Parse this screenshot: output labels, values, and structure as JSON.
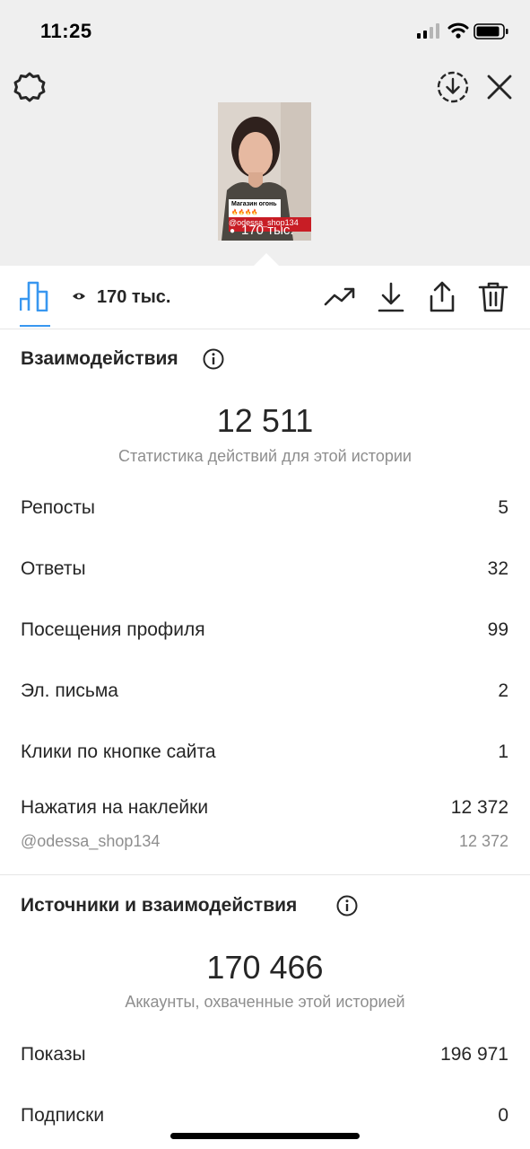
{
  "status_bar": {
    "time": "11:25"
  },
  "story": {
    "caption_title": "Магазин огонь",
    "mention": "@odessa_shop134",
    "views": "170 тыс."
  },
  "toolbar": {
    "views": "170 тыс."
  },
  "interactions": {
    "title": "Взаимодействия",
    "total": "12 511",
    "subtitle": "Статистика действий для этой истории",
    "rows": [
      {
        "label": "Репосты",
        "value": "5"
      },
      {
        "label": "Ответы",
        "value": "32"
      },
      {
        "label": "Посещения профиля",
        "value": "99"
      },
      {
        "label": "Эл. письма",
        "value": "2"
      },
      {
        "label": "Клики по кнопке сайта",
        "value": "1"
      },
      {
        "label": "Нажатия на наклейки",
        "value": "12 372"
      }
    ],
    "sticker_sub": {
      "label": "@odessa_shop134",
      "value": "12 372"
    }
  },
  "discovery": {
    "title": "Источники и взаимодействия",
    "total": "170 466",
    "subtitle": "Аккаунты, охваченные этой историей",
    "rows": [
      {
        "label": "Показы",
        "value": "196 971"
      },
      {
        "label": "Подписки",
        "value": "0"
      }
    ]
  },
  "colors": {
    "accent": "#3897f0",
    "text": "#262626",
    "secondary": "#8e8e8e",
    "top_bg": "#efefef"
  }
}
